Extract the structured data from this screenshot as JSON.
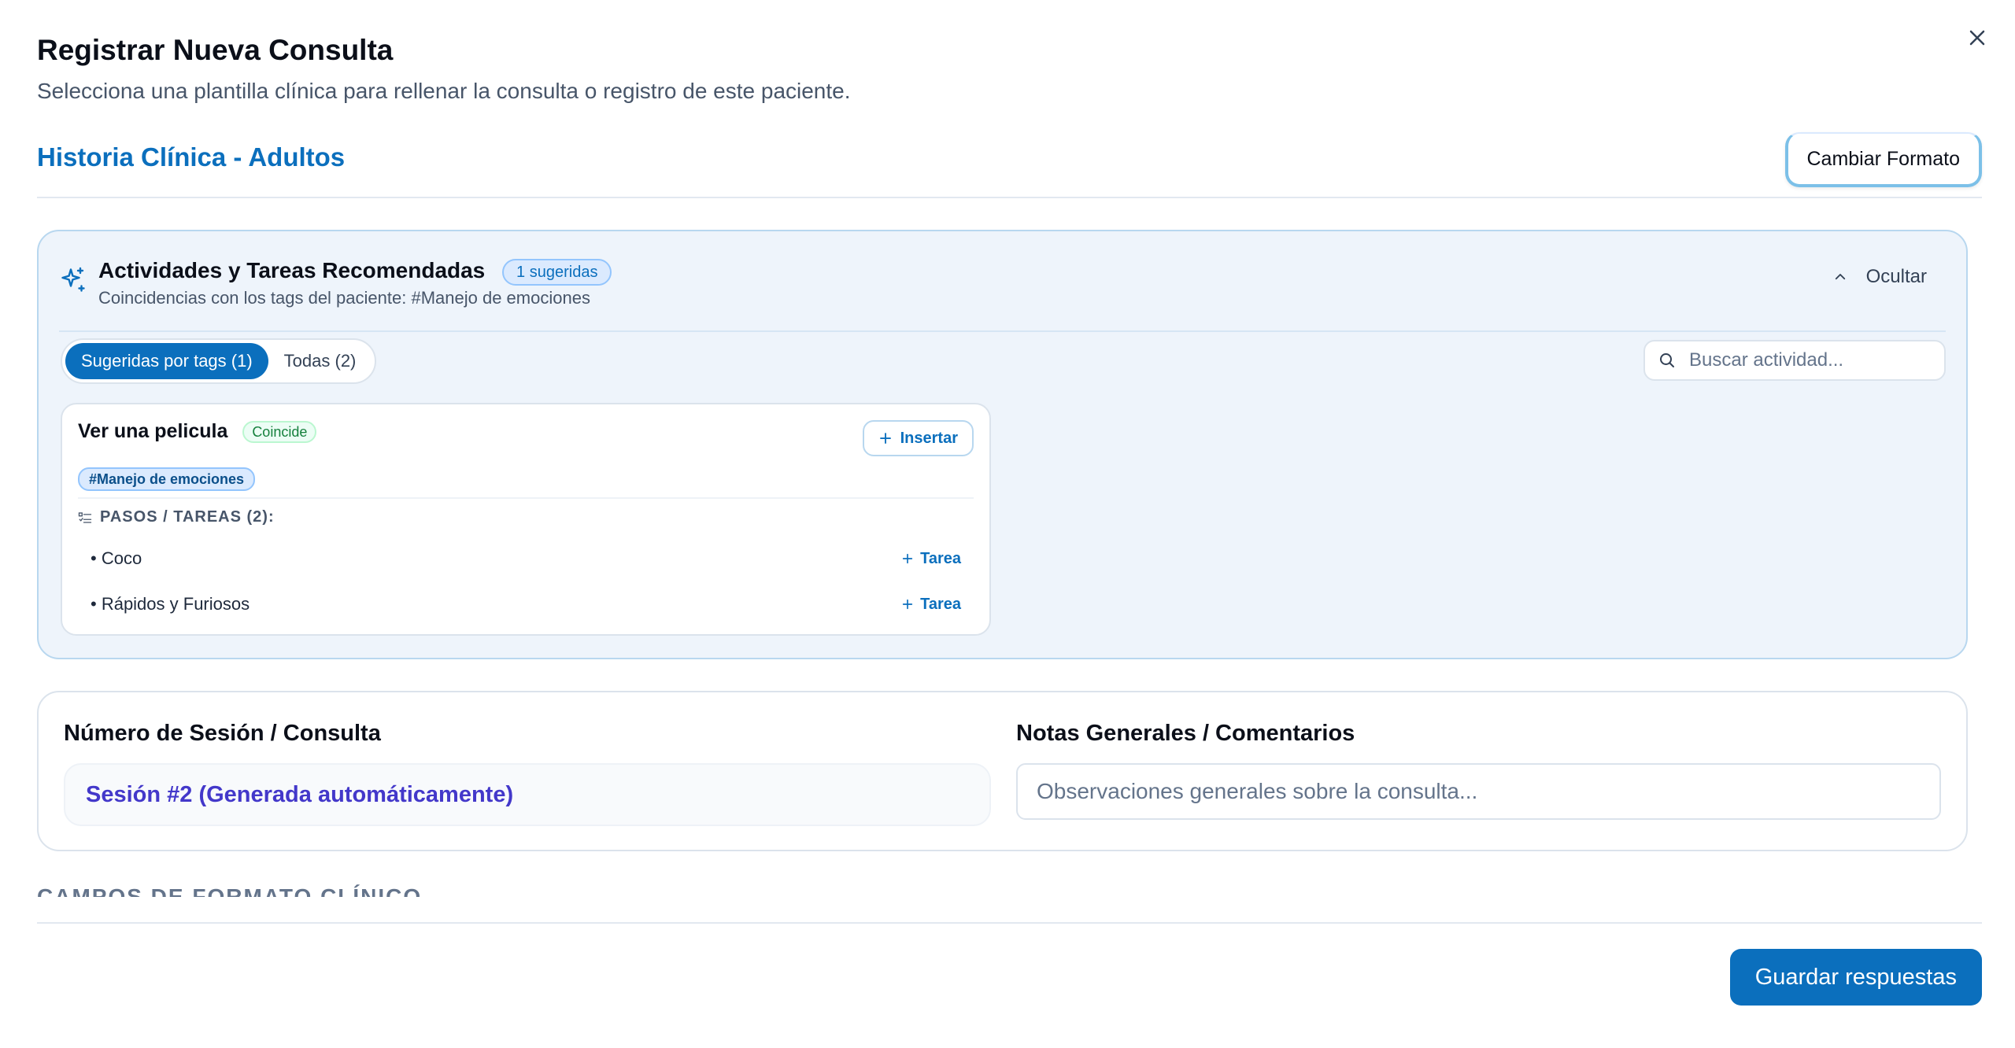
{
  "modal": {
    "title": "Registrar Nueva Consulta",
    "subtitle": "Selecciona una plantilla clínica para rellenar la consulta o registro de este paciente.",
    "close_icon": "close-icon"
  },
  "format": {
    "name": "Historia Clínica - Adultos",
    "change_label": "Cambiar Formato"
  },
  "recommendations": {
    "icon": "sparkles-icon",
    "title": "Actividades y Tareas Recomendadas",
    "badge": "1 sugeridas",
    "subtitle": "Coincidencias con los tags del paciente: #Manejo de emociones",
    "hide_label": "Ocultar",
    "tabs": [
      {
        "label": "Sugeridas por tags (1)",
        "active": true
      },
      {
        "label": "Todas (2)",
        "active": false
      }
    ],
    "search_placeholder": "Buscar actividad...",
    "activity": {
      "title": "Ver una pelicula",
      "match_badge": "Coincide",
      "insert_label": "Insertar",
      "tag": "#Manejo de emociones",
      "steps_header": "PASOS / TAREAS (2):",
      "steps": [
        {
          "label": "• Coco",
          "action": "Tarea"
        },
        {
          "label": "• Rápidos y Furiosos",
          "action": "Tarea"
        }
      ]
    }
  },
  "session": {
    "number_label": "Número de Sesión / Consulta",
    "number_value": "Sesión #2 (Generada automáticamente)",
    "notes_label": "Notas Generales / Comentarios",
    "notes_placeholder": "Observaciones generales sobre la consulta..."
  },
  "section_heading": "CAMPOS DE FORMATO CLÍNICO",
  "footer": {
    "save_label": "Guardar respuestas"
  },
  "colors": {
    "primary": "#0b6fbd",
    "session_text": "#4338ca",
    "panel_bg": "#eef4fb"
  }
}
